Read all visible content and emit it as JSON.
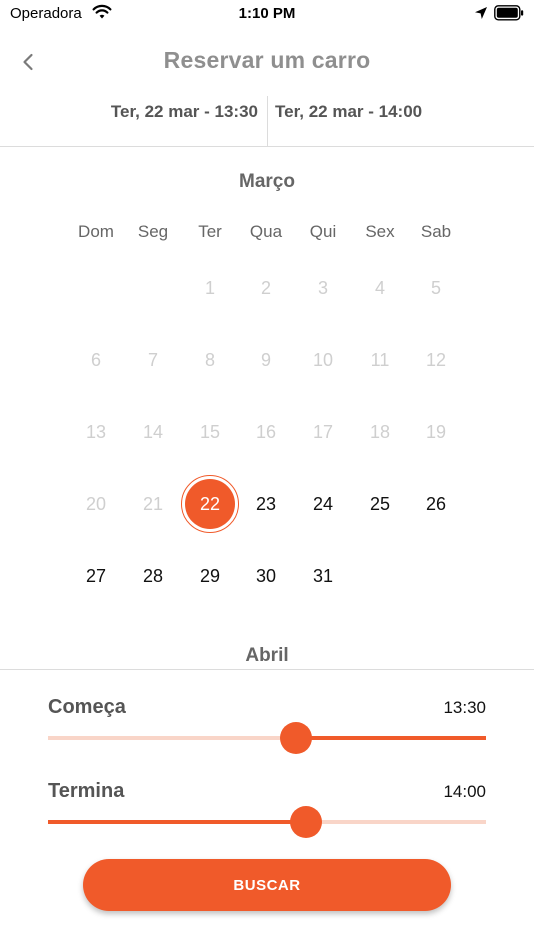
{
  "status_bar": {
    "carrier": "Operadora",
    "time": "1:10 PM"
  },
  "header": {
    "title": "Reservar um carro",
    "back_icon": "chevron-left-icon"
  },
  "date_range": {
    "start": "Ter, 22 mar - 13:30",
    "end": "Ter, 22 mar - 14:00"
  },
  "calendar": {
    "month": "Março",
    "next_month": "Abril",
    "weekdays": [
      "Dom",
      "Seg",
      "Ter",
      "Qua",
      "Qui",
      "Sex",
      "Sab"
    ],
    "first_weekday_index": 2,
    "days_in_month": 31,
    "selected_day": 22
  },
  "start_slider": {
    "label": "Começa",
    "value": "13:30",
    "fraction": 0.567
  },
  "end_slider": {
    "label": "Termina",
    "value": "14:00",
    "fraction": 0.588
  },
  "actions": {
    "search_label": "BUSCAR"
  },
  "colors": {
    "accent": "#f05a2a",
    "accent_light": "#f9d5c8",
    "muted_text": "#8f8f8f",
    "disabled_day": "#cfcfcf"
  }
}
